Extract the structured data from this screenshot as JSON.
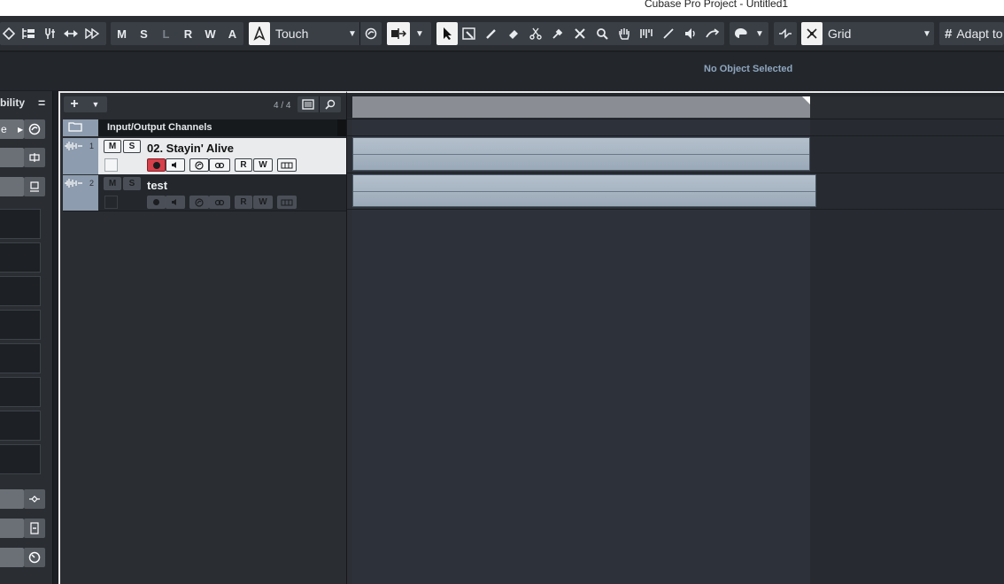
{
  "window": {
    "title": "Cubase Pro Project - Untitled1"
  },
  "toolbar": {
    "automation_buttons": [
      "M",
      "S",
      "L",
      "R",
      "W",
      "A"
    ],
    "automation_mode": "Touch",
    "snap_type": "Grid",
    "adapt_label": "Adapt to"
  },
  "infoline": {
    "status": "No Object Selected"
  },
  "inspector": {
    "visibility_label": "bility",
    "menu_label": "=",
    "row_label": "e"
  },
  "tracklist": {
    "add_label": "+",
    "count": "4 / 4",
    "folder": {
      "name": "Input/Output Channels"
    },
    "tracks": [
      {
        "number": "1",
        "name": "02. Stayin' Alive",
        "mute": "M",
        "solo": "S",
        "read": "R",
        "write": "W"
      },
      {
        "number": "2",
        "name": "test",
        "mute": "M",
        "solo": "S",
        "read": "R",
        "write": "W"
      }
    ]
  },
  "colors": {
    "track_color": "#8d9cae",
    "record_active": "#d6404a",
    "event_fill": "#a9b6c3",
    "selected_row": "#e9ebed"
  }
}
